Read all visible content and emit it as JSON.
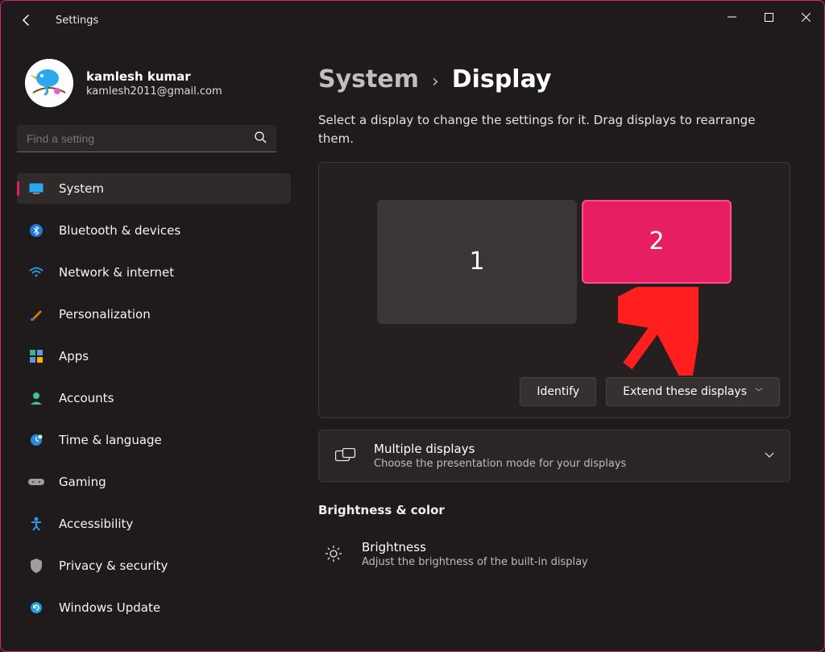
{
  "app": {
    "title": "Settings"
  },
  "profile": {
    "name": "kamlesh kumar",
    "email": "kamlesh2011@gmail.com"
  },
  "search": {
    "placeholder": "Find a setting"
  },
  "sidebar": {
    "items": [
      {
        "id": "system",
        "label": "System",
        "icon": "display-icon",
        "active": true
      },
      {
        "id": "bluetooth",
        "label": "Bluetooth & devices",
        "icon": "bluetooth-icon"
      },
      {
        "id": "network",
        "label": "Network & internet",
        "icon": "wifi-icon"
      },
      {
        "id": "personalization",
        "label": "Personalization",
        "icon": "brush-icon"
      },
      {
        "id": "apps",
        "label": "Apps",
        "icon": "apps-icon"
      },
      {
        "id": "accounts",
        "label": "Accounts",
        "icon": "person-icon"
      },
      {
        "id": "time",
        "label": "Time & language",
        "icon": "clock-icon"
      },
      {
        "id": "gaming",
        "label": "Gaming",
        "icon": "gamepad-icon"
      },
      {
        "id": "accessibility",
        "label": "Accessibility",
        "icon": "accessibility-icon"
      },
      {
        "id": "privacy",
        "label": "Privacy & security",
        "icon": "shield-icon"
      },
      {
        "id": "update",
        "label": "Windows Update",
        "icon": "update-icon"
      }
    ]
  },
  "breadcrumb": {
    "parent": "System",
    "current": "Display"
  },
  "display": {
    "helptext": "Select a display to change the settings for it. Drag displays to rearrange them.",
    "monitors": [
      {
        "id": 1,
        "label": "1",
        "selected": false
      },
      {
        "id": 2,
        "label": "2",
        "selected": true
      }
    ],
    "identify_label": "Identify",
    "mode_label": "Extend these displays",
    "multiple": {
      "title": "Multiple displays",
      "desc": "Choose the presentation mode for your displays"
    },
    "brightness_section": "Brightness & color",
    "brightness": {
      "title": "Brightness",
      "desc": "Adjust the brightness of the built-in display"
    }
  }
}
